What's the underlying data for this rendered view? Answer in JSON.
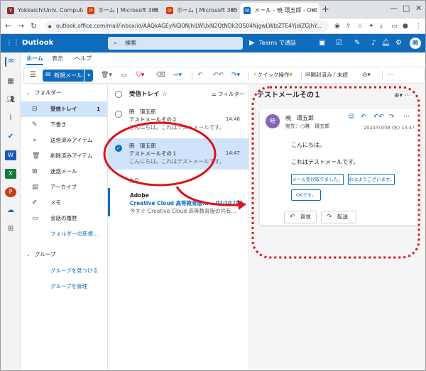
{
  "browser": {
    "tabs": [
      {
        "label": "YokkaichiUniv. Compute",
        "icon": "Y",
        "icon_color": "#8e2b2b"
      },
      {
        "label": "ホーム | Microsoft 365",
        "icon": "⟳",
        "icon_color": "#d83b01"
      },
      {
        "label": "ホーム | Microsoft 365",
        "icon": "⟳",
        "icon_color": "#d83b01"
      },
      {
        "label": "メール - 暁 環五郎 - Out",
        "icon": "✉",
        "icon_color": "#0f6cbd"
      }
    ],
    "new_tab": "+",
    "url": "outlook.office.com/mail/inbox/id/AAQkAGEyNGI0NjhlLWUxN2QtNDk2OS04NjgwLWIzZTE4YjdiZGJhY..."
  },
  "outlook": {
    "app_name": "Outlook",
    "search_placeholder": "検索",
    "teams_label": "Teams で通話",
    "accent": "#0f6cbd"
  },
  "ribbon": {
    "tabs": [
      "ホーム",
      "表示",
      "ヘルプ"
    ],
    "new_mail": "新規メール",
    "quick_steps": "クイック操作",
    "read_unread": "開封済み / 未読"
  },
  "folders": {
    "header": "フォルダー",
    "items": [
      {
        "label": "受信トレイ",
        "count": "1",
        "icon": "inbox"
      },
      {
        "label": "下書き",
        "count": "",
        "icon": "draft"
      },
      {
        "label": "送信済みアイテム",
        "count": "",
        "icon": "sent"
      },
      {
        "label": "削除済みアイテム",
        "count": "",
        "icon": "trash"
      },
      {
        "label": "迷惑メール",
        "count": "",
        "icon": "junk"
      },
      {
        "label": "アーカイブ",
        "count": "",
        "icon": "archive"
      },
      {
        "label": "メモ",
        "count": "",
        "icon": "note"
      },
      {
        "label": "会話の履歴",
        "count": "",
        "icon": "history"
      }
    ],
    "new_folder": "フォルダーの新規...",
    "groups_header": "グループ",
    "find_groups": "グループを見つける",
    "manage_groups": "グループを管理"
  },
  "message_list": {
    "title": "受信トレイ",
    "filter": "フィルター",
    "messages": [
      {
        "sender": "暁　環五郎",
        "subject": "テストメールその２",
        "preview": "こんにちは。これはテストメールです。",
        "time": "14:48"
      },
      {
        "sender": "暁　環五郎",
        "subject": "テストメールその１",
        "preview": "こんにちは。これはテストメールです。",
        "time": "14:47"
      }
    ],
    "group_label": "先月",
    "older": {
      "sender": "Adobe",
      "subject": "Creative Cloud 高等教育版...",
      "preview": "今すぐ Creative Cloud 高等教育版の共有...",
      "time": "02/10 (金)"
    }
  },
  "reading": {
    "subject": "テストメールその１",
    "from": "暁　環五郎",
    "to_label": "宛先：",
    "to": "暁　環五郎",
    "date": "2023/03/08 (水) 14:47",
    "body_line1": "こんにちは。",
    "body_line2": "これはテストメールです。",
    "quick_replies": [
      "メール受け取りました。",
      "おはようございます。",
      "OKです。"
    ],
    "reply": "返信",
    "forward": "転送"
  }
}
